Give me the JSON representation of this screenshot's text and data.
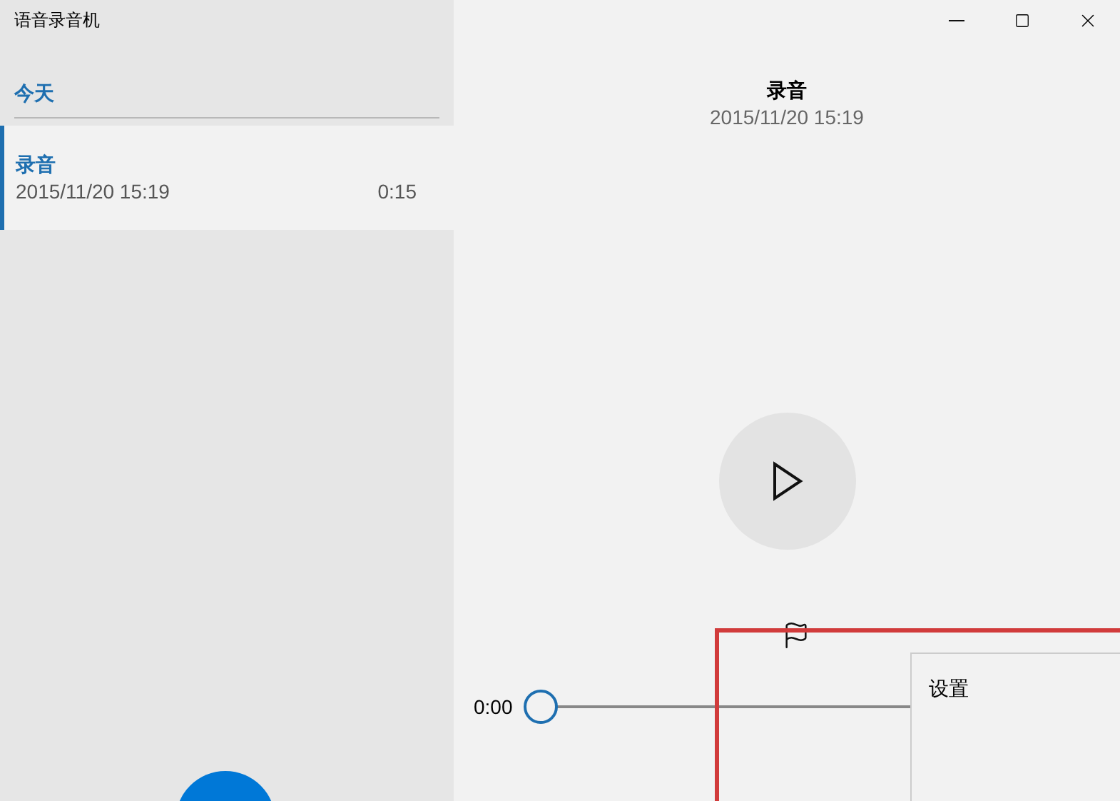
{
  "window": {
    "title": "语音录音机"
  },
  "list": {
    "group": "今天",
    "items": [
      {
        "title": "录音",
        "date": "2015/11/20 15:19",
        "duration": "0:15",
        "selected": true
      }
    ]
  },
  "detail": {
    "title": "录音",
    "date": "2015/11/20 15:19"
  },
  "player": {
    "time": "0:00",
    "level": 0
  },
  "menu": {
    "items": [
      "设置"
    ]
  }
}
